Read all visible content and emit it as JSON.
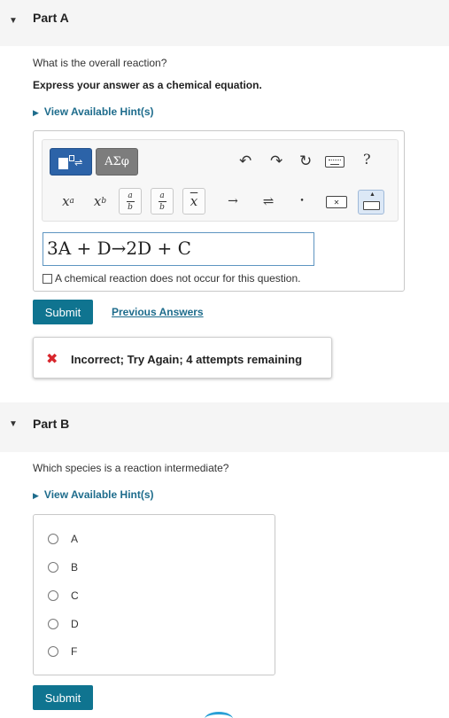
{
  "part_a": {
    "title": "Part A",
    "question": "What is the overall reaction?",
    "instruction": "Express your answer as a chemical equation.",
    "hint_link": "View Available Hint(s)",
    "toolbar": {
      "symbols_label": "ΑΣφ",
      "help_label": "?",
      "superscript": "x",
      "superscript_sup": "a",
      "subscript": "x",
      "subscript_sub": "b",
      "frac_num": "a",
      "frac_den": "b",
      "overline_label": "x",
      "arrow_label": "→",
      "equilibrium_label": "⇌",
      "dot_label": "•"
    },
    "answer_value": "3A + D→2D + C",
    "no_reaction_label": "A chemical reaction does not occur for this question.",
    "submit_label": "Submit",
    "previous_answers_label": "Previous Answers",
    "feedback": {
      "icon": "✖",
      "message": "Incorrect; Try Again; 4 attempts remaining",
      "icon_color": "#d8262c"
    }
  },
  "part_b": {
    "title": "Part B",
    "question": "Which species is a reaction intermediate?",
    "hint_link": "View Available Hint(s)",
    "options": [
      "A",
      "B",
      "C",
      "D",
      "F"
    ],
    "submit_label": "Submit"
  },
  "colors": {
    "submit_bg": "#0f7490",
    "link": "#1e6c8c",
    "templates_btn": "#2c63a8",
    "header_bg": "#f5f5f5"
  }
}
